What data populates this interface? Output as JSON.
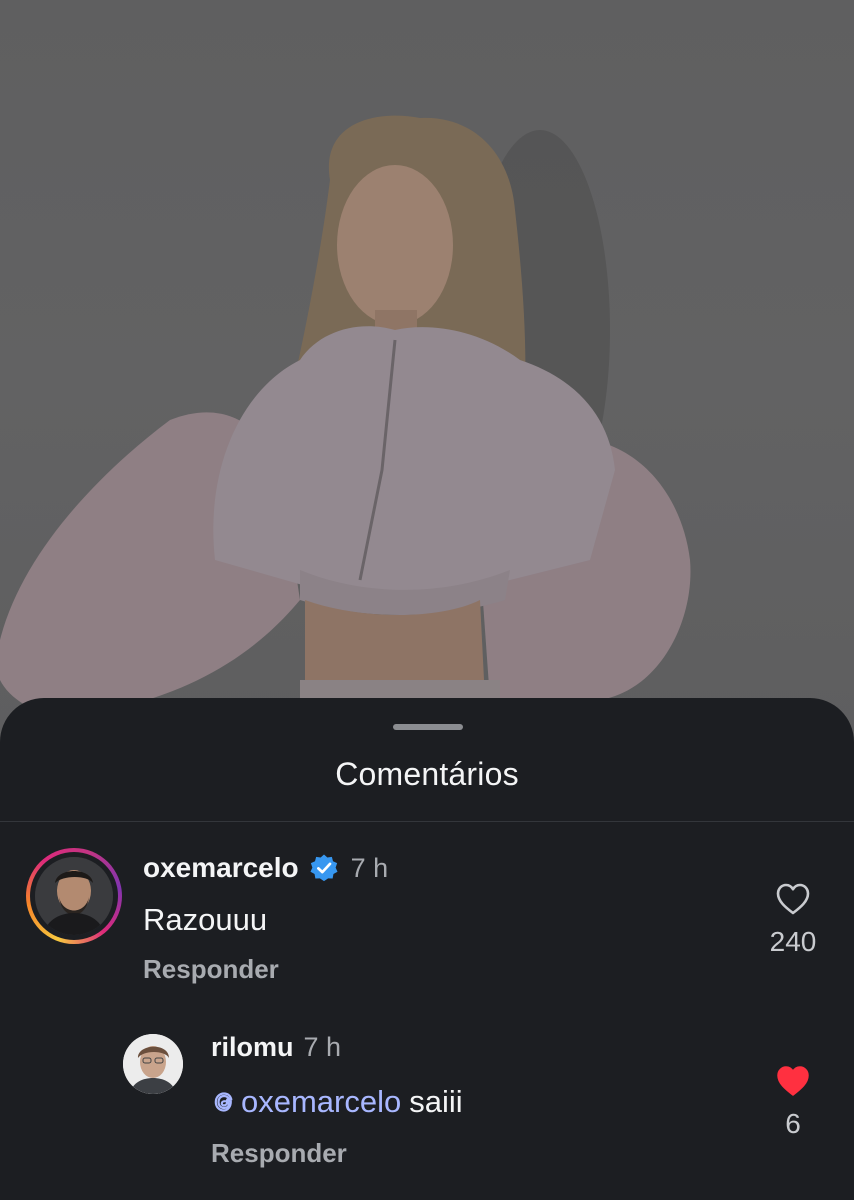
{
  "sheet": {
    "title": "Comentários"
  },
  "comments": [
    {
      "username": "oxemarcelo",
      "verified": true,
      "time": "7 h",
      "text": "Razouuu",
      "reply_label": "Responder",
      "likes": "240",
      "liked": false,
      "avatar_icon": "profile-photo-man-dark-hair"
    },
    {
      "username": "rilomu",
      "verified": false,
      "time": "7 h",
      "mention": "oxemarcelo",
      "text": "saiii",
      "reply_label": "Responder",
      "likes": "6",
      "liked": true,
      "avatar_icon": "profile-photo-young-man"
    }
  ],
  "colors": {
    "sheet_background": "#1c1e22",
    "primary_text": "#f4f5f6",
    "secondary_text": "#a8abb0",
    "verified_blue": "#3797f0",
    "liked_red": "#ff3040",
    "mention_blue": "#a8b7ff"
  }
}
